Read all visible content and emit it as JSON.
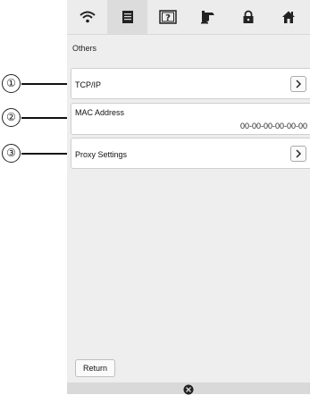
{
  "callouts": [
    "①",
    "②",
    "③"
  ],
  "tabs": [
    {
      "name": "wifi-icon",
      "active": false
    },
    {
      "name": "document-icon",
      "active": true
    },
    {
      "name": "help-icon",
      "active": false
    },
    {
      "name": "sewing-machine-icon",
      "active": false
    },
    {
      "name": "lock-icon",
      "active": false
    },
    {
      "name": "home-icon",
      "active": false
    }
  ],
  "section_title": "Others",
  "rows": {
    "tcpip": {
      "label": "TCP/IP"
    },
    "mac": {
      "label": "MAC Address",
      "value": "00-00-00-00-00-00"
    },
    "proxy": {
      "label": "Proxy Settings"
    }
  },
  "return_label": "Return"
}
